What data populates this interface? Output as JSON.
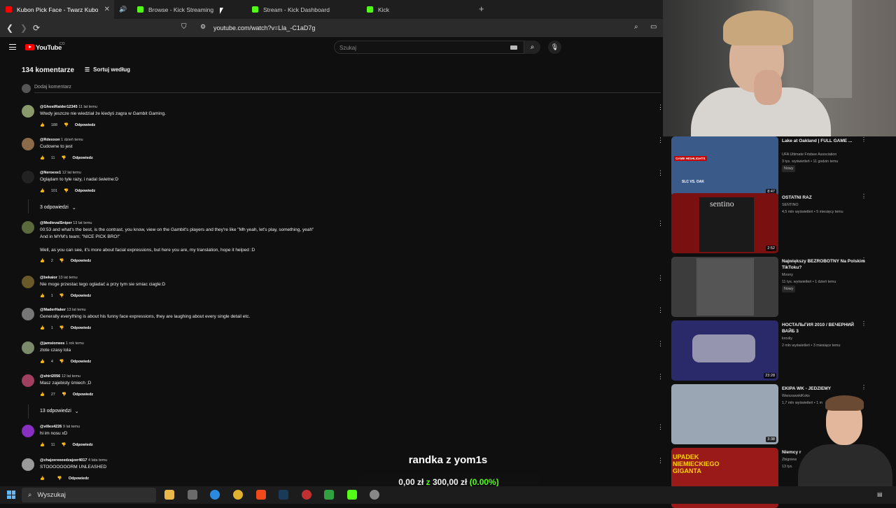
{
  "browser": {
    "tabs": [
      {
        "label": "Kubon Pick Face - Twarz Kubona",
        "active": true,
        "favicon": "youtube-icon"
      },
      {
        "label": "Browse - Kick Streaming",
        "active": false,
        "favicon": "kick-icon"
      },
      {
        "label": "Stream - Kick Dashboard",
        "active": false,
        "favicon": "kick-icon"
      },
      {
        "label": "Kick",
        "active": false,
        "favicon": "kick-icon"
      }
    ],
    "close_glyph": "✕",
    "newtab_glyph": "+",
    "url": "youtube.com/watch?v=Lla_-C1aD7g"
  },
  "youtube": {
    "logo_text": "YouTube",
    "logo_suffix": "CO",
    "search_placeholder": "Szukaj",
    "comments_count": "134 komentarze",
    "sort_label": "Sortuj według",
    "add_comment": "Dodaj komentarz",
    "reply_label": "Odpowiedz"
  },
  "comments": [
    {
      "author": "@GhostRaider12345",
      "time": "11 lat temu",
      "lines": [
        "Wtedy jeszcze nie wiedział że kiedyś zagra w Gambit Gaming."
      ],
      "likes": "188",
      "avatar_color": "#8a9a6a"
    },
    {
      "author": "@Rdexxon",
      "time": "1 dzień temu",
      "lines": [
        "Cudowne to jest"
      ],
      "likes": "11",
      "avatar_color": "#8b6a4a"
    },
    {
      "author": "@Neroexe1",
      "time": "12 lat temu",
      "lines": [
        "Oglądam to tyle razy, i nadal świetne:D"
      ],
      "likes": "101",
      "avatar_color": "#222222"
    },
    {
      "author": "@MedievalSniper",
      "time": "13 lat temu",
      "lines": [
        "00:53 and what's the best, is the contrast, you know, view on the Gambit's players and they're like \"Mh yeah, let's play, something, yeah\"",
        "And in MYM's team; \"NICE PICK BRO!\"",
        "",
        "Well, as you can see, it's more about facial expressions, but here you are, my translation, hope it helped :D"
      ],
      "likes": "2",
      "avatar_color": "#5a6a3a"
    },
    {
      "author": "@bekaior",
      "time": "13 lat temu",
      "lines": [
        "Nie moge przestac tego ogladać a przy tym sie smiac ciagle:D"
      ],
      "likes": "1",
      "avatar_color": "#6a5a2a"
    },
    {
      "author": "@MaderHaker",
      "time": "13 lat temu",
      "lines": [
        "Generally everything is about his funny face expressions, they are laughing about every single detail etc."
      ],
      "likes": "1",
      "avatar_color": "#777777"
    },
    {
      "author": "@jamsiorwes",
      "time": "1 rok temu",
      "lines": [
        "zlote czasy lola"
      ],
      "likes": "4",
      "avatar_color": "#7a8a6a"
    },
    {
      "author": "@shiri2056",
      "time": "12 lat temu",
      "lines": [
        "Masz zajebisty śmiech ;D"
      ],
      "likes": "27",
      "avatar_color": "#a04060"
    },
    {
      "author": "@villex4226",
      "time": "9 lat temu",
      "lines": [
        "hi im nosu xD"
      ],
      "likes": "11",
      "avatar_color": "#8a30c0"
    },
    {
      "author": "@chajzereeeedzajzer4017",
      "time": "4 lata temu",
      "lines": [
        "STOOOOOOORM UNLEASHED"
      ],
      "likes": "",
      "avatar_color": "#999999"
    }
  ],
  "replies": [
    {
      "label": "3 odpowiedzi"
    },
    {
      "label": "13 odpowiedzi"
    }
  ],
  "sidebar_videos": [
    {
      "title": "Lake at Oakland | FULL GAME ...",
      "channel": "UFA Ultimate Frisbee Association",
      "stats": "3 tys. wyświetleń • 11 godzin temu",
      "badge": "Nowy",
      "duration": "8:47",
      "thumb": "#3a5a8a"
    },
    {
      "title": "OSTATNI RAZ",
      "channel": "SENTINO",
      "stats": "4,5 mln wyświetleń • 5 miesięcy temu",
      "badge": "",
      "duration": "2:52",
      "thumb": "#7a1010"
    },
    {
      "title": "Największy BEZROBOTNY Na Polskim TikToku?",
      "channel": "Moony",
      "stats": "11 tys. wyświetleń • 1 dzień temu",
      "badge": "Nowy",
      "duration": "",
      "thumb": "#3c3c3c"
    },
    {
      "title": "НОСТАЛЬГИЯ 2010 / ВЕЧЕРНИЙ ВАЙБ 3",
      "channel": "krovliy",
      "stats": "2 mln wyświetleń • 3 miesiące temu",
      "badge": "",
      "duration": "23:28",
      "thumb": "#2a2a6a"
    },
    {
      "title": "EKIPA WK - JEDZIEMY",
      "channel": "WarszawskiKoks",
      "stats": "1,7 mln wyświetleń • 1 m",
      "badge": "",
      "duration": "3:38",
      "thumb": "#9aa6b4"
    },
    {
      "title": "Niemcy r",
      "channel": "Zbigniew",
      "stats": "13 tys.",
      "badge": "",
      "duration": "",
      "thumb": "#9a1a1a"
    }
  ],
  "thumb_texts": {
    "game_highlights": "GAME HIGHLIGHTS",
    "teams": "SLC VS. OAK",
    "sentino": "sentino",
    "upadek": "UPADEK NIEMIECKIEGO GIGANTA"
  },
  "overlay": {
    "title": "randka z yom1s",
    "goal_current": "0,00 zł",
    "goal_sep": "z",
    "goal_target": "300,00 zł",
    "goal_pct": "(0.00%)"
  },
  "taskbar": {
    "search_label": "Wyszukaj"
  },
  "colors": {
    "youtube_red": "#ff0000",
    "kick_green": "#53fc18",
    "background": "#0f0f0f"
  }
}
